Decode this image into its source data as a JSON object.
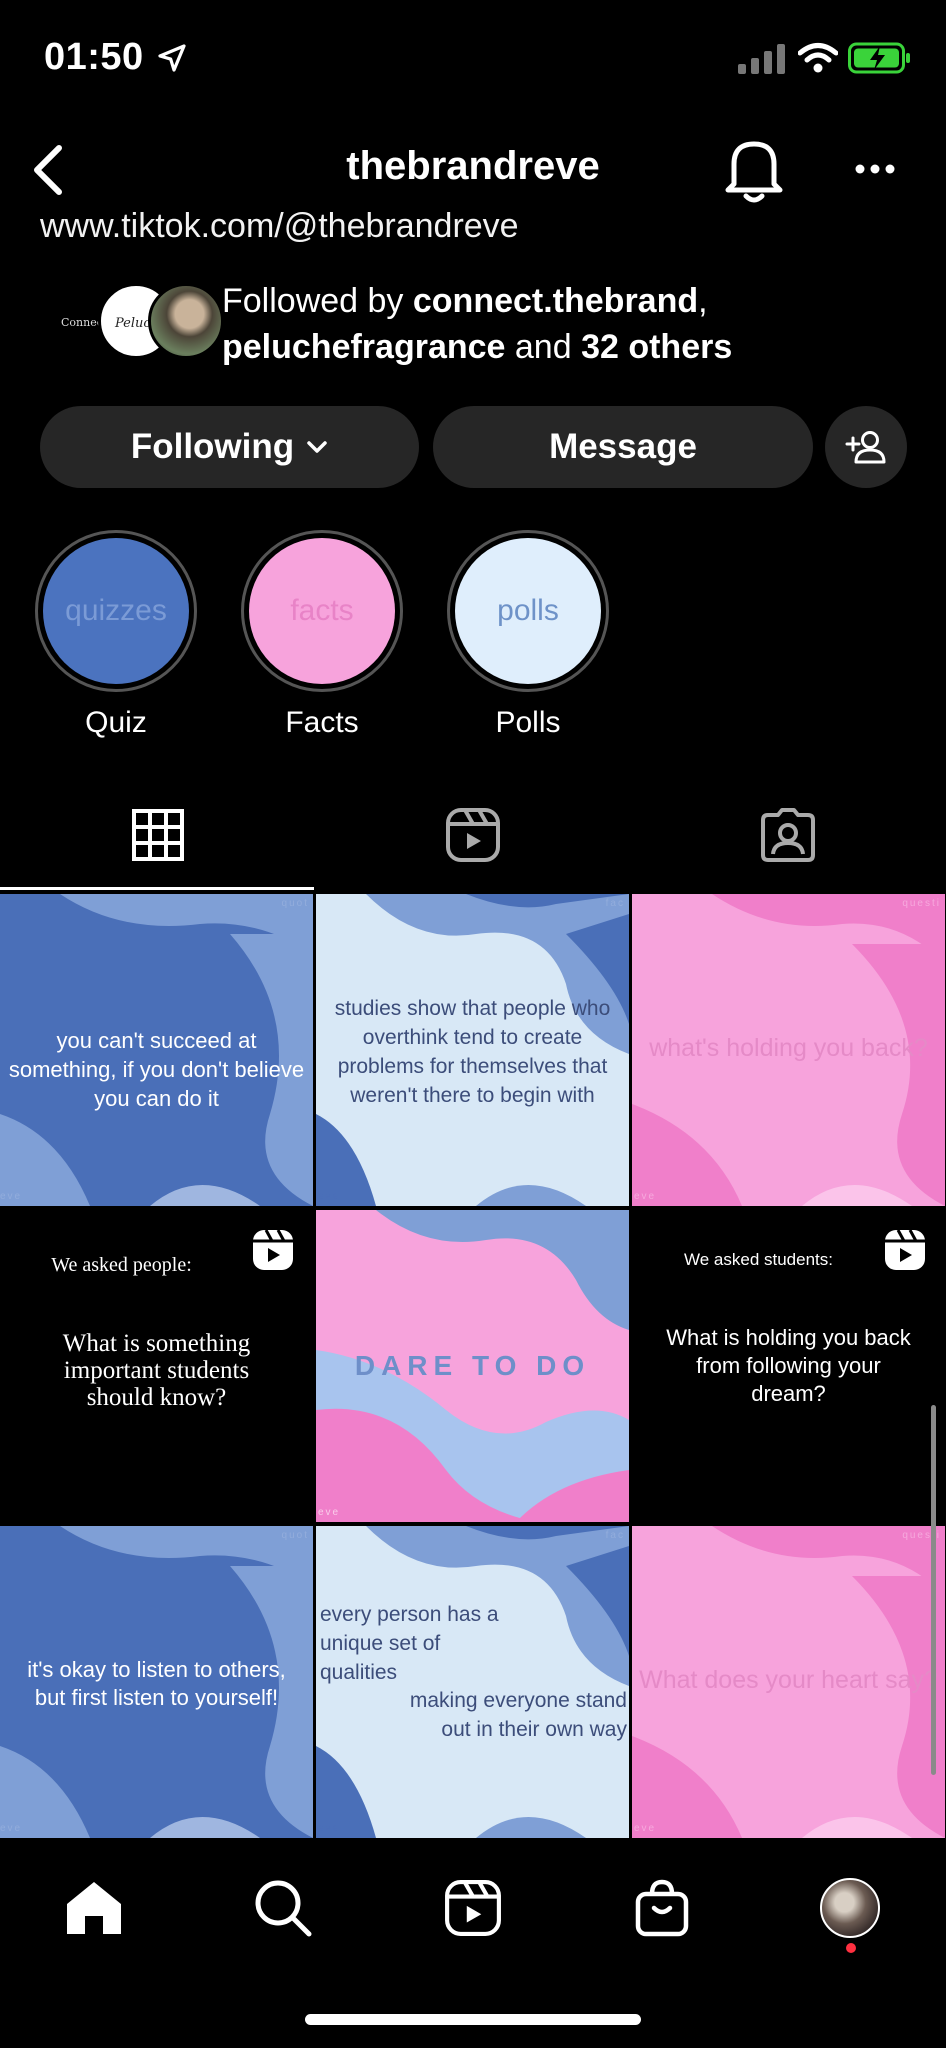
{
  "status_bar": {
    "time": "01:50"
  },
  "header": {
    "username": "thebrandreve"
  },
  "profile": {
    "link": "www.tiktok.com/@thebrandreve",
    "followed_prefix": "Followed by ",
    "followed_user1": "connect.thebrand",
    "followed_sep": ",",
    "followed_user2": "peluchefragrance",
    "followed_and": " and ",
    "followed_others": "32 others",
    "avatar1_text": "Connect",
    "avatar2_text": "Peluche"
  },
  "actions": {
    "following_label": "Following",
    "message_label": "Message"
  },
  "highlights": [
    {
      "cover_text": "quizzes",
      "label": "Quiz",
      "bg": "#4b73bf",
      "fg": "#7b9bd6"
    },
    {
      "cover_text": "facts",
      "label": "Facts",
      "bg": "#f7a3dc",
      "fg": "#e883c7"
    },
    {
      "cover_text": "polls",
      "label": "Polls",
      "bg": "#dfeefc",
      "fg": "#6e92c8"
    }
  ],
  "tabs": [
    "grid-tab",
    "reels-tab",
    "tagged-tab"
  ],
  "posts": [
    {
      "text": "you can't succeed at something, if you don't believe you can do it",
      "style": "blue"
    },
    {
      "text": "studies show that people who overthink tend to create problems for themselves that weren't there to begin with",
      "style": "lightblue"
    },
    {
      "text": "what's holding you back?",
      "style": "pink"
    },
    {
      "kicker": "We asked people:",
      "text": "What is something important students should know?",
      "style": "black"
    },
    {
      "text": "DARE TO DO",
      "style": "pinkblue"
    },
    {
      "kicker": "We asked students:",
      "text": "What is holding you back from following your dream?",
      "style": "black"
    },
    {
      "text": "it's okay to listen to others, but first listen to yourself!",
      "style": "blue"
    },
    {
      "text_top": "every person has a unique set of qualities",
      "text_bottom": "making everyone stand out in their own way",
      "style": "lightblue"
    },
    {
      "text": "What does your heart say?",
      "style": "pink"
    }
  ],
  "corner_labels": {
    "blue": "quot",
    "lightblue": "fac",
    "pink": "questi",
    "bottom": "eve"
  },
  "colors": {
    "blue_dark": "#4a6fb8",
    "blue_light": "#7f9fd6",
    "lightblue": "#d8e8f6",
    "pink": "#f7a3dc",
    "pink_dark": "#f07fca"
  }
}
